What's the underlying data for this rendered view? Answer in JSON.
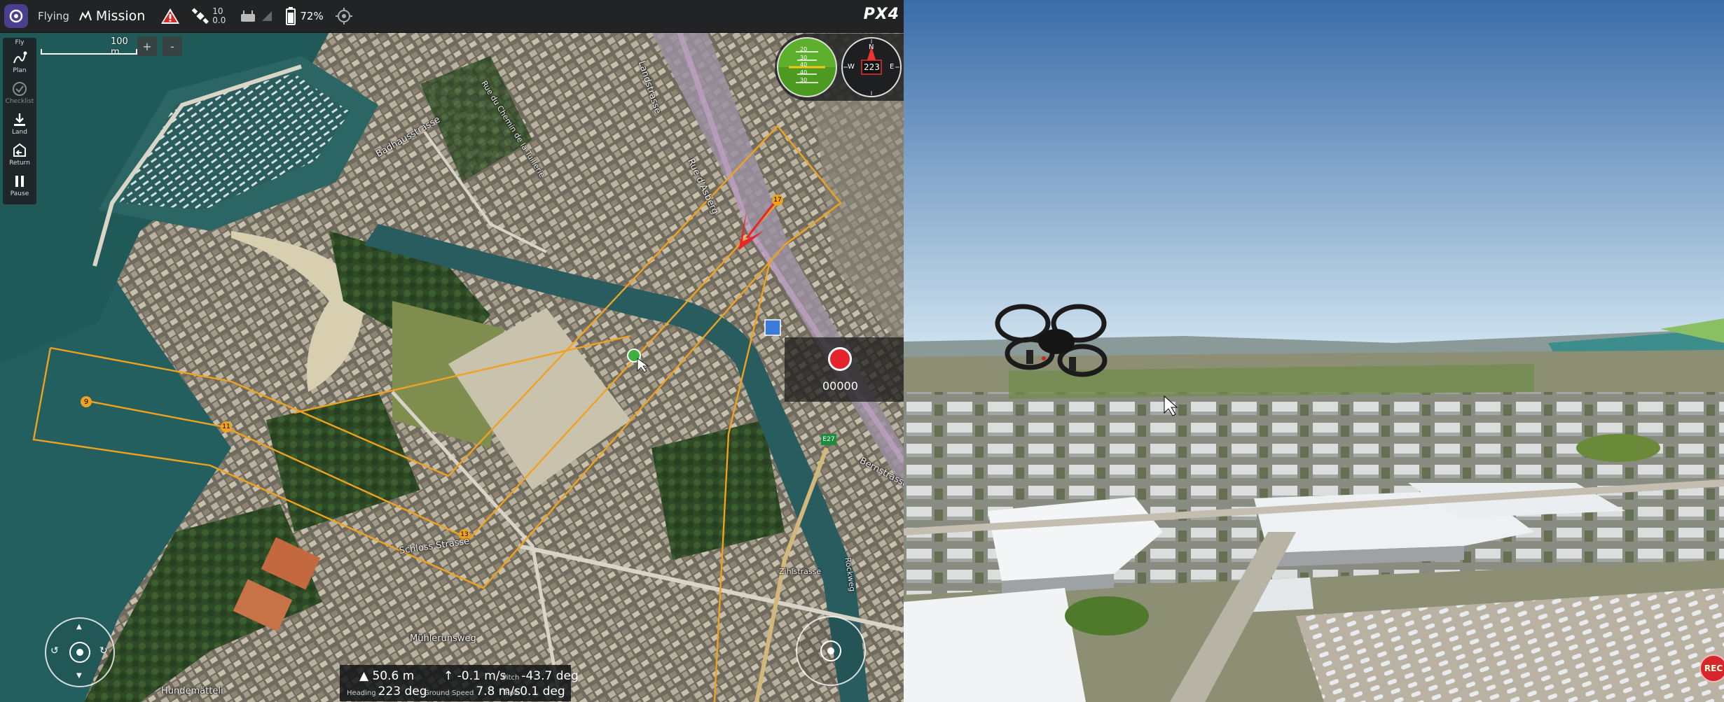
{
  "toolbar": {
    "flight_status": "Flying",
    "flight_mode": "Mission",
    "satellite_count": "10",
    "hdop": "0.0",
    "battery": "72%",
    "brand": "PX4"
  },
  "toolstrip": {
    "items": [
      {
        "label": "Fly"
      },
      {
        "label": "Plan"
      },
      {
        "label": "Checklist"
      },
      {
        "label": "Land"
      },
      {
        "label": "Return"
      },
      {
        "label": "Pause"
      }
    ]
  },
  "map": {
    "scale_label": "100 m",
    "zoom_in": "+",
    "zoom_out": "-",
    "street_labels": [
      "Badhausstrasse",
      "Rue du Chemin de la Tuillerie",
      "Landstrasse",
      "Rue d'Asberg",
      "Bernstrasse",
      "Schloss Strasse",
      "Mühlerunsweg",
      "Hundemätteli",
      "Zihlstrasse",
      "Rockweg"
    ],
    "waypoints": [
      "9",
      "11",
      "13",
      "17"
    ],
    "vehicle_heading_marker": "vehicle-arrow",
    "highway_badge": "E27"
  },
  "recording": {
    "time": "00000"
  },
  "compass": {
    "heading": "223",
    "n": "N",
    "e": "E",
    "w": "W"
  },
  "attitude": {
    "ticks": [
      "20",
      "30",
      "40",
      "40",
      "30"
    ]
  },
  "telemetry": {
    "altitude": "50.6 m",
    "vertical_speed": "-0.1 m/s",
    "pitch_label": "Pitch",
    "pitch": "-43.7 deg",
    "heading_label": "Heading",
    "heading": "223 deg",
    "ground_speed_label": "Ground Speed",
    "ground_speed": "7.8 m/s",
    "roll_label": "Roll",
    "roll": "0.1 deg"
  },
  "video": {
    "rec_label": "REC"
  },
  "colors": {
    "toolbar_bg": "#222324",
    "mission_path": "#f0a21e",
    "record_red": "#e5232b"
  }
}
